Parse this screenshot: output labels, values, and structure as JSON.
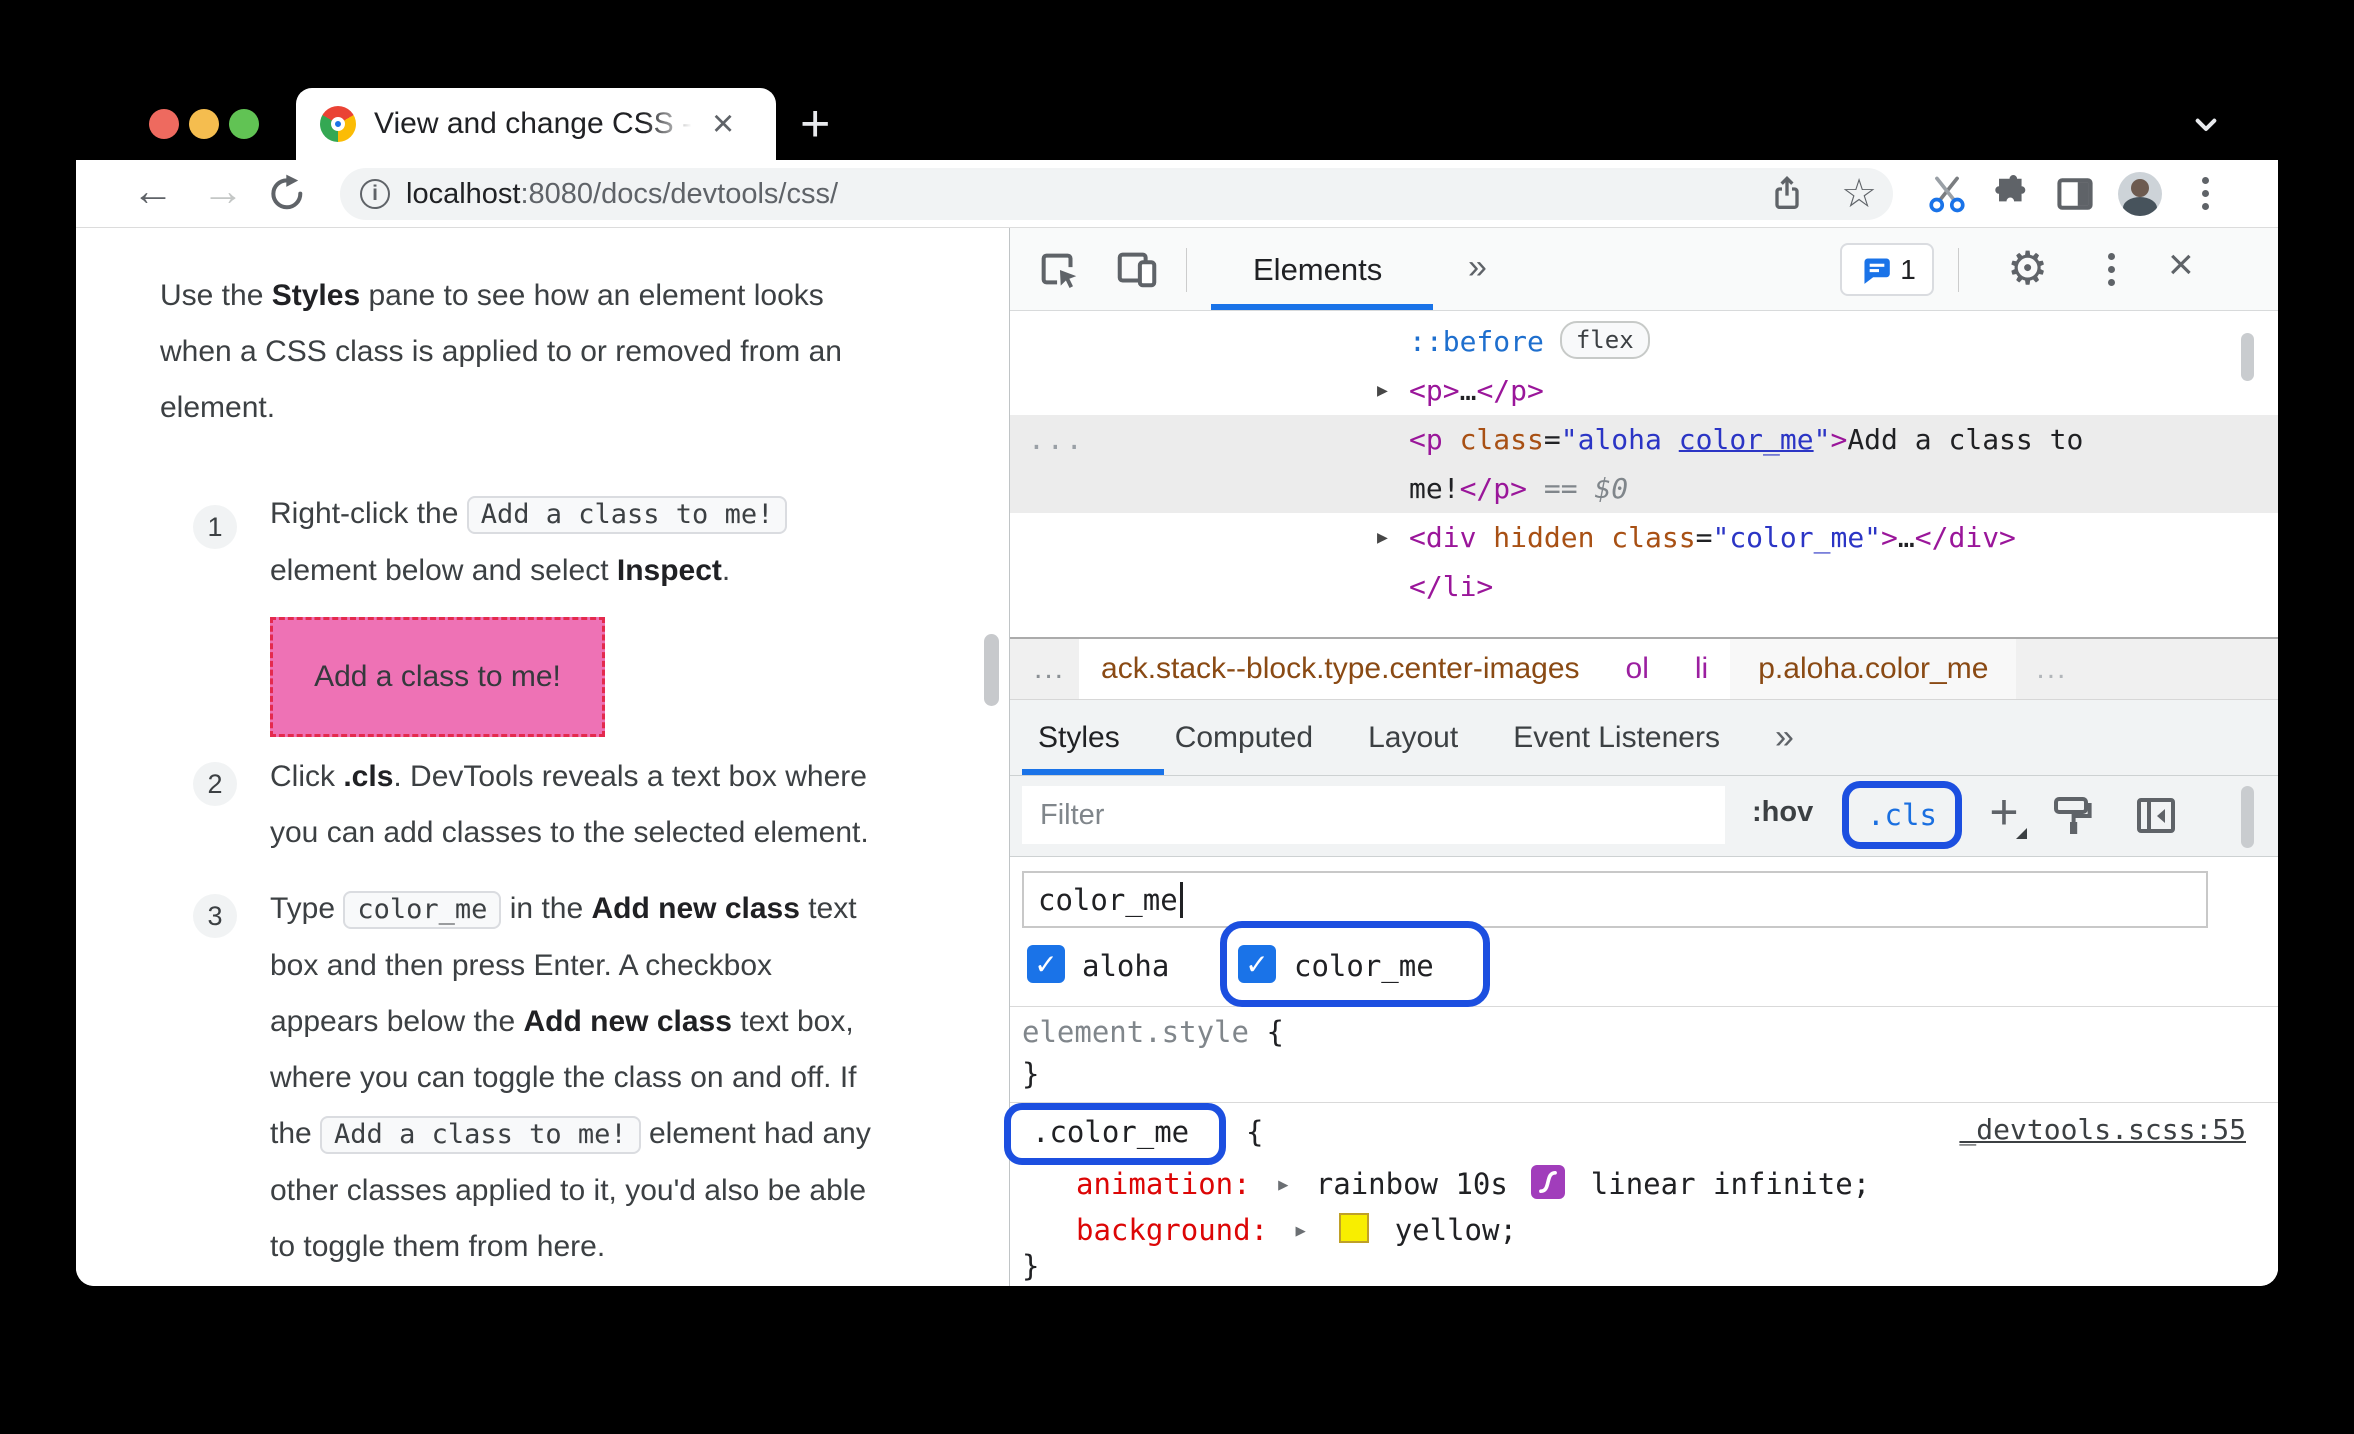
{
  "colors": {
    "accent_blue": "#1a73e8",
    "annotation_blue": "#1c4fe0",
    "pink_box_bg": "#ee72b5",
    "pink_box_border": "#e42a4e",
    "tag_purple": "#9a169a",
    "attr_orange": "#a85014",
    "value_blue": "#2b35c5",
    "property_red": "#dc0606",
    "swatch_yellow": "#f8ee00"
  },
  "icons": {
    "back": "←",
    "forward": "→",
    "star": "☆",
    "gear": "⚙",
    "close": "×",
    "tab_close": "×",
    "new_tab": "+",
    "plus": "+",
    "more_tabs": "»",
    "more_panes": "»",
    "info": "i",
    "check": "✓",
    "dom_arrow": "▶"
  },
  "browser": {
    "tab_title": "View and change CSS - Chrome",
    "url": {
      "host": "localhost",
      "path": ":8080/docs/devtools/css/"
    }
  },
  "doc": {
    "intro_runs": [
      {
        "t": "t",
        "s": "Use the "
      },
      {
        "t": "b",
        "s": "Styles"
      },
      {
        "t": "t",
        "s": " pane to see how an element looks"
      },
      {
        "t": "br"
      },
      {
        "t": "t",
        "s": "when a CSS class is applied to or removed from an"
      },
      {
        "t": "br"
      },
      {
        "t": "t",
        "s": "element."
      }
    ],
    "steps": [
      {
        "num": "1",
        "runs": [
          {
            "t": "t",
            "s": "Right-click the "
          },
          {
            "t": "c",
            "s": "Add a class to me!"
          },
          {
            "t": "br"
          },
          {
            "t": "t",
            "s": "element below and select "
          },
          {
            "t": "b",
            "s": "Inspect"
          },
          {
            "t": "t",
            "s": "."
          }
        ]
      },
      {
        "num": "2",
        "runs": [
          {
            "t": "t",
            "s": "Click "
          },
          {
            "t": "b",
            "s": ".cls"
          },
          {
            "t": "t",
            "s": ". DevTools reveals a text box where"
          },
          {
            "t": "br"
          },
          {
            "t": "t",
            "s": "you can add classes to the selected element."
          }
        ]
      },
      {
        "num": "3",
        "runs": [
          {
            "t": "t",
            "s": "Type "
          },
          {
            "t": "c",
            "s": "color_me"
          },
          {
            "t": "t",
            "s": " in the "
          },
          {
            "t": "b",
            "s": "Add new class"
          },
          {
            "t": "t",
            "s": " text"
          },
          {
            "t": "br"
          },
          {
            "t": "t",
            "s": "box and then press Enter. A checkbox"
          },
          {
            "t": "br"
          },
          {
            "t": "t",
            "s": "appears below the "
          },
          {
            "t": "b",
            "s": "Add new class"
          },
          {
            "t": "t",
            "s": " text box,"
          },
          {
            "t": "br"
          },
          {
            "t": "t",
            "s": "where you can toggle the class on and off. If"
          },
          {
            "t": "br"
          },
          {
            "t": "t",
            "s": "the "
          },
          {
            "t": "c",
            "s": "Add a class to me!"
          },
          {
            "t": "t",
            "s": " element had any"
          },
          {
            "t": "br"
          },
          {
            "t": "t",
            "s": "other classes applied to it, you'd also be able"
          },
          {
            "t": "br"
          },
          {
            "t": "t",
            "s": "to toggle them from here."
          }
        ]
      }
    ],
    "pink_box_label": "Add a class to me!"
  },
  "devtools": {
    "toolbar": {
      "tab_label": "Elements",
      "comment_count": "1"
    },
    "dom": {
      "rows": [
        {
          "tokens": [
            {
              "s": "::before",
              "c": "pseudo"
            },
            {
              "s": "flex",
              "c": "badge"
            }
          ]
        },
        {
          "arrow": true,
          "tokens": [
            {
              "s": "<p>",
              "c": "tag"
            },
            {
              "s": "…",
              "c": "txt"
            },
            {
              "s": "</p>",
              "c": "tag"
            }
          ]
        },
        {
          "selected": true,
          "guide": "...",
          "lines": [
            [
              {
                "s": "<p ",
                "c": "tag"
              },
              {
                "s": "class",
                "c": "attr"
              },
              {
                "s": "=",
                "c": "txt"
              },
              {
                "s": "\"aloha ",
                "c": "val"
              },
              {
                "s": "color_me",
                "c": "valu"
              },
              {
                "s": "\"",
                "c": "val"
              },
              {
                "s": ">",
                "c": "tag"
              },
              {
                "s": "Add a class to",
                "c": "txt"
              }
            ],
            [
              {
                "s": "me!",
                "c": "txt"
              },
              {
                "s": "</p>",
                "c": "tag"
              },
              {
                "s": " == ",
                "c": "gray"
              },
              {
                "s": "$0",
                "c": "grayi"
              }
            ]
          ]
        },
        {
          "arrow": true,
          "tokens": [
            {
              "s": "<div",
              "c": "tag"
            },
            {
              "s": " hidden",
              "c": "attr"
            },
            {
              "s": " class",
              "c": "attr"
            },
            {
              "s": "=",
              "c": "txt"
            },
            {
              "s": "\"color_me\"",
              "c": "val"
            },
            {
              "s": ">",
              "c": "tag"
            },
            {
              "s": "…",
              "c": "txt"
            },
            {
              "s": "</div>",
              "c": "tag"
            }
          ]
        },
        {
          "tokens": [
            {
              "s": "</li>",
              "c": "tag"
            }
          ]
        }
      ]
    },
    "breadcrumbs": {
      "overflow_left": "...",
      "items_white": [
        {
          "label": "ack.stack--block.type.center-images"
        },
        {
          "label": "ol"
        },
        {
          "label": "li"
        }
      ],
      "item_selected": {
        "label": "p.aloha.color_me"
      },
      "overflow_right": "..."
    },
    "pane_tabs": [
      {
        "label": "Styles",
        "active": true
      },
      {
        "label": "Computed",
        "active": false
      },
      {
        "label": "Layout",
        "active": false
      },
      {
        "label": "Event Listeners",
        "active": false
      }
    ],
    "filter": {
      "placeholder": "Filter",
      "hov_label": ":hov",
      "cls_label": ".cls"
    },
    "class_editor": {
      "input_value": "color_me",
      "checkboxes": [
        {
          "label": "aloha",
          "checked": true
        },
        {
          "label": "color_me",
          "checked": true
        }
      ]
    },
    "element_style_rule": {
      "selector": "element.style",
      "open": " {",
      "close": "}"
    },
    "color_me_rule": {
      "selector": ".color_me",
      "open": "{",
      "close": "}",
      "source": "_devtools.scss:55",
      "props": [
        {
          "name": "animation:",
          "value_pre": "rainbow 10s",
          "value_post": "linear infinite;"
        },
        {
          "name": "background:",
          "value": "yellow;"
        }
      ]
    }
  }
}
